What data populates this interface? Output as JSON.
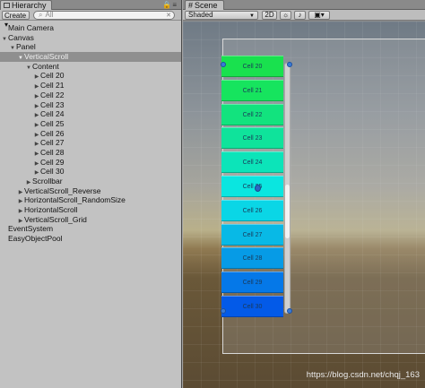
{
  "hierarchy": {
    "tab_label": "Hierarchy",
    "create_label": "Create",
    "search_placeholder": "All",
    "items": [
      {
        "label": "Main Camera",
        "depth": 0,
        "arrow": ""
      },
      {
        "label": "Canvas",
        "depth": 0,
        "arrow": "▼"
      },
      {
        "label": "Panel",
        "depth": 1,
        "arrow": "▼"
      },
      {
        "label": "VerticalScroll",
        "depth": 2,
        "arrow": "▼",
        "selected": true
      },
      {
        "label": "Content",
        "depth": 3,
        "arrow": "▼"
      },
      {
        "label": "Cell 20",
        "depth": 4,
        "arrow": "▶"
      },
      {
        "label": "Cell 21",
        "depth": 4,
        "arrow": "▶"
      },
      {
        "label": "Cell 22",
        "depth": 4,
        "arrow": "▶"
      },
      {
        "label": "Cell 23",
        "depth": 4,
        "arrow": "▶"
      },
      {
        "label": "Cell 24",
        "depth": 4,
        "arrow": "▶"
      },
      {
        "label": "Cell 25",
        "depth": 4,
        "arrow": "▶"
      },
      {
        "label": "Cell 26",
        "depth": 4,
        "arrow": "▶"
      },
      {
        "label": "Cell 27",
        "depth": 4,
        "arrow": "▶"
      },
      {
        "label": "Cell 28",
        "depth": 4,
        "arrow": "▶"
      },
      {
        "label": "Cell 29",
        "depth": 4,
        "arrow": "▶"
      },
      {
        "label": "Cell 30",
        "depth": 4,
        "arrow": "▶"
      },
      {
        "label": "Scrollbar",
        "depth": 3,
        "arrow": "▶"
      },
      {
        "label": "VerticalScroll_Reverse",
        "depth": 2,
        "arrow": "▶"
      },
      {
        "label": "HorizontalScroll_RandomSize",
        "depth": 2,
        "arrow": "▶"
      },
      {
        "label": "HorizontalScroll",
        "depth": 2,
        "arrow": "▶"
      },
      {
        "label": "VerticalScroll_Grid",
        "depth": 2,
        "arrow": "▶"
      },
      {
        "label": "EventSystem",
        "depth": 0,
        "arrow": ""
      },
      {
        "label": "EasyObjectPool",
        "depth": 0,
        "arrow": ""
      }
    ]
  },
  "scene": {
    "tab_label": "Scene",
    "shading_mode": "Shaded",
    "mode_2d_label": "2D",
    "cells": [
      {
        "label": "Cell 20",
        "color": "#19e14e"
      },
      {
        "label": "Cell 21",
        "color": "#16e45e"
      },
      {
        "label": "Cell 22",
        "color": "#12e37e"
      },
      {
        "label": "Cell 23",
        "color": "#0fe39b"
      },
      {
        "label": "Cell 24",
        "color": "#0ce4b9"
      },
      {
        "label": "Cell 25",
        "color": "#0ae6e0"
      },
      {
        "label": "Cell 26",
        "color": "#0ad6e6"
      },
      {
        "label": "Cell 27",
        "color": "#08b9e6"
      },
      {
        "label": "Cell 28",
        "color": "#069be6"
      },
      {
        "label": "Cell 29",
        "color": "#0578e8"
      },
      {
        "label": "Cell 30",
        "color": "#035ae8"
      }
    ]
  },
  "watermark": "https://blog.csdn.net/chqj_163"
}
